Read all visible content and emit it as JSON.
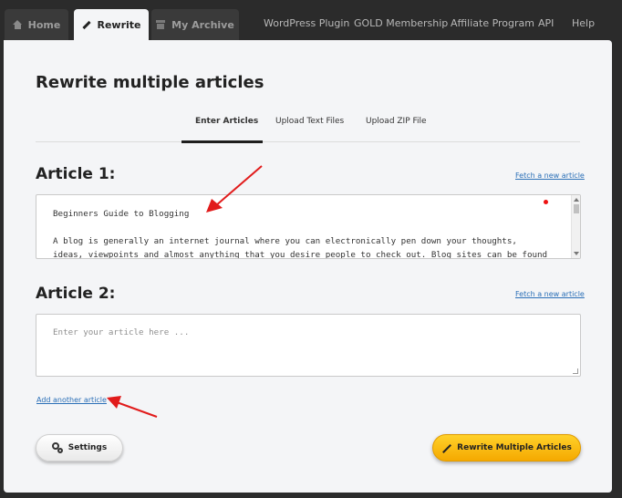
{
  "nav": {
    "tabs": [
      {
        "label": "Home",
        "icon": "home-icon"
      },
      {
        "label": "Rewrite",
        "icon": "pencil-icon"
      },
      {
        "label": "My Archive",
        "icon": "archive-icon"
      }
    ],
    "links": [
      "WordPress Plugin",
      "GOLD Membership",
      "Affiliate Program",
      "API",
      "Help"
    ]
  },
  "main": {
    "title": "Rewrite multiple articles",
    "subtabs": [
      "Enter Articles",
      "Upload Text Files",
      "Upload ZIP File"
    ],
    "active_subtab": "Enter Articles",
    "articles": [
      {
        "heading": "Article 1:",
        "fetch_label": "Fetch a new article",
        "lines": [
          "Beginners Guide to Blogging",
          "A blog is generally an internet journal where you can electronically pen down your thoughts,",
          "ideas, viewpoints and almost anything that you desire people to check out. Blog sites can be found"
        ]
      },
      {
        "heading": "Article 2:",
        "fetch_label": "Fetch a new article",
        "placeholder": "Enter your article here ..."
      }
    ],
    "add_article_label": "Add another article",
    "settings_label": "Settings",
    "rewrite_label": "Rewrite Multiple Articles"
  },
  "colors": {
    "accent": "#ffc20e",
    "annotation_arrow": "#e11b1b",
    "link": "#2a6fb7",
    "nav_background": "#2b2b2b"
  }
}
